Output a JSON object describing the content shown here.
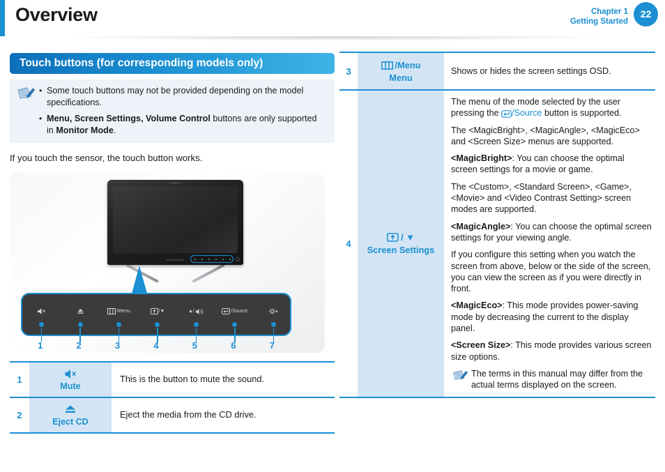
{
  "header": {
    "title": "Overview",
    "chapter_line1": "Chapter 1",
    "chapter_line2": "Getting Started",
    "page_number": "22",
    "accent_color": "#1b8fd1"
  },
  "left": {
    "section_title": "Touch buttons (for corresponding models only)",
    "notes": [
      {
        "bullet": "•",
        "text_parts": [
          {
            "text": "Some touch buttons may not be provided depending on the model specifications.",
            "bold": false
          }
        ]
      },
      {
        "bullet": "•",
        "text_parts": [
          {
            "text": "Menu, Screen Settings, Volume Control",
            "bold": true
          },
          {
            "text": " buttons are only supported in ",
            "bold": false
          },
          {
            "text": "Monitor Mode",
            "bold": true
          },
          {
            "text": ".",
            "bold": false
          }
        ]
      }
    ],
    "lead_text": "If you touch the sensor, the touch button works.",
    "button_bar": [
      {
        "index": "1",
        "glyph": "mute-icon",
        "label": ""
      },
      {
        "index": "2",
        "glyph": "eject-icon",
        "label": ""
      },
      {
        "index": "3",
        "glyph": "menu-icon",
        "label": "/Menu"
      },
      {
        "index": "4",
        "glyph": "screen-settings-icon",
        "label": "/▼"
      },
      {
        "index": "5",
        "glyph": "volume-icon",
        "label": "▲/"
      },
      {
        "index": "6",
        "glyph": "source-icon",
        "label": "/Source"
      },
      {
        "index": "7",
        "glyph": "power-icon",
        "label": ""
      }
    ],
    "numbers": [
      "1",
      "2",
      "3",
      "4",
      "5",
      "6",
      "7"
    ],
    "table_rows": [
      {
        "num": "1",
        "key_glyph": "mute-icon",
        "key_label": "Mute",
        "desc": "This is the button to mute the sound."
      },
      {
        "num": "2",
        "key_glyph": "eject-icon",
        "key_label": "Eject CD",
        "desc": "Eject the media from the CD drive."
      }
    ]
  },
  "right": {
    "rows": [
      {
        "num": "3",
        "key_glyph": "menu-icon",
        "key_glyph_suffix": "/Menu",
        "key_label": "Menu",
        "paragraphs": [
          {
            "runs": [
              {
                "text": "Shows or hides the screen settings OSD.",
                "style": "normal"
              }
            ]
          }
        ]
      },
      {
        "num": "4",
        "key_glyph": "screen-settings-icon",
        "key_glyph_suffix": "/ ▼",
        "key_label": "Screen Settings",
        "paragraphs": [
          {
            "runs": [
              {
                "text": "The menu of the mode selected by the user pressing the ",
                "style": "normal"
              },
              {
                "text": "[source-icon]",
                "style": "icon"
              },
              {
                "text": "/Source",
                "style": "link"
              },
              {
                "text": " button is supported.",
                "style": "normal"
              }
            ]
          },
          {
            "runs": [
              {
                "text": "The <MagicBright>, <MagicAngle>, <MagicEco> and <Screen Size> menus are supported.",
                "style": "normal"
              }
            ]
          },
          {
            "runs": [
              {
                "text": "<MagicBright>",
                "style": "bold"
              },
              {
                "text": ": You can choose the optimal screen settings for a movie or game.",
                "style": "normal"
              }
            ]
          },
          {
            "runs": [
              {
                "text": "The <Custom>, <Standard Screen>, <Game>, <Movie> and <Video Contrast Setting> screen modes are supported.",
                "style": "normal"
              }
            ]
          },
          {
            "runs": [
              {
                "text": "<MagicAngle>",
                "style": "bold"
              },
              {
                "text": ":  You can choose the optimal screen settings for your viewing angle.",
                "style": "normal"
              }
            ]
          },
          {
            "runs": [
              {
                "text": "If you configure this setting when you watch the screen from above, below or the side of the screen, you can view the screen as if you were directly in front.",
                "style": "normal"
              }
            ]
          },
          {
            "runs": [
              {
                "text": "<MagicEco>",
                "style": "bold"
              },
              {
                "text": ": This mode provides power-saving mode by decreasing the current to the display panel.",
                "style": "normal"
              }
            ]
          },
          {
            "runs": [
              {
                "text": "<Screen Size>",
                "style": "bold"
              },
              {
                "text": ": This mode provides various screen size options.",
                "style": "normal"
              }
            ]
          }
        ],
        "sub_note": "The terms in this manual may differ from the actual terms displayed on the screen."
      }
    ]
  },
  "colors": {
    "accent_blue": "#1b8fd1",
    "key_cell_bg": "#d3e5f5",
    "note_bg": "#eef3f9",
    "bar_dark": "#3b3b3b"
  }
}
